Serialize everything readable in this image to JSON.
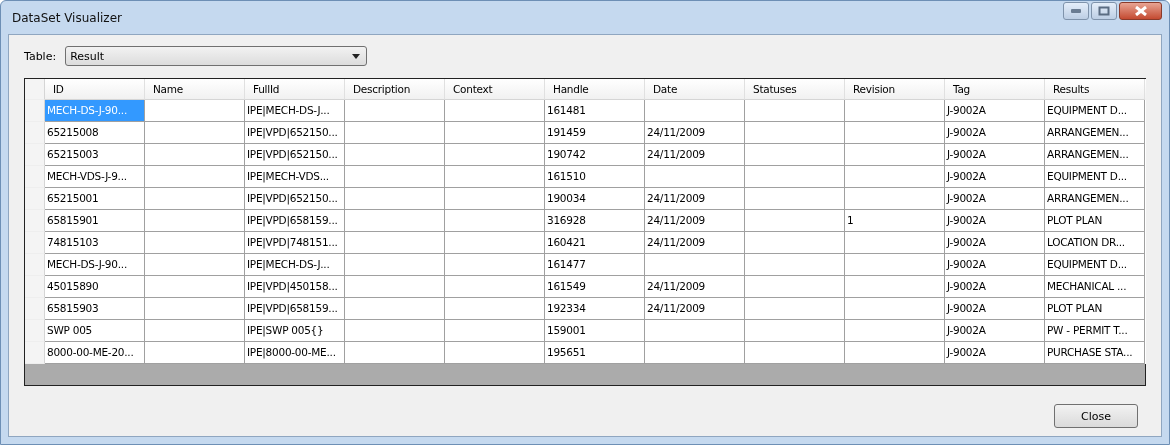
{
  "window": {
    "title": "DataSet Visualizer"
  },
  "table_selector": {
    "label": "Table:",
    "value": "Result"
  },
  "grid": {
    "columns": [
      "ID",
      "Name",
      "FullId",
      "Description",
      "Context",
      "Handle",
      "Date",
      "Statuses",
      "Revision",
      "Tag",
      "Results"
    ],
    "rows": [
      {
        "selected": true,
        "cells": [
          "MECH-DS-J-90...",
          null,
          "IPE|MECH-DS-J...",
          null,
          null,
          "161481",
          null,
          null,
          null,
          "J-9002A",
          "EQUIPMENT D..."
        ]
      },
      {
        "selected": false,
        "cells": [
          "65215008",
          null,
          "IPE|VPD|652150...",
          null,
          null,
          "191459",
          "24/11/2009",
          null,
          null,
          "J-9002A",
          "ARRANGEMEN..."
        ]
      },
      {
        "selected": false,
        "cells": [
          "65215003",
          null,
          "IPE|VPD|652150...",
          null,
          null,
          "190742",
          "24/11/2009",
          null,
          null,
          "J-9002A",
          "ARRANGEMEN..."
        ]
      },
      {
        "selected": false,
        "cells": [
          "MECH-VDS-J-9...",
          null,
          "IPE|MECH-VDS...",
          null,
          null,
          "161510",
          null,
          null,
          null,
          "J-9002A",
          "EQUIPMENT D..."
        ]
      },
      {
        "selected": false,
        "cells": [
          "65215001",
          null,
          "IPE|VPD|652150...",
          null,
          null,
          "190034",
          "24/11/2009",
          null,
          null,
          "J-9002A",
          "ARRANGEMEN..."
        ]
      },
      {
        "selected": false,
        "cells": [
          "65815901",
          null,
          "IPE|VPD|658159...",
          null,
          null,
          "316928",
          "24/11/2009",
          null,
          "1",
          "J-9002A",
          "PLOT PLAN"
        ]
      },
      {
        "selected": false,
        "cells": [
          "74815103",
          null,
          "IPE|VPD|748151...",
          null,
          null,
          "160421",
          "24/11/2009",
          null,
          null,
          "J-9002A",
          "LOCATION DR..."
        ]
      },
      {
        "selected": false,
        "cells": [
          "MECH-DS-J-90...",
          null,
          "IPE|MECH-DS-J...",
          null,
          null,
          "161477",
          null,
          null,
          null,
          "J-9002A",
          "EQUIPMENT D..."
        ]
      },
      {
        "selected": false,
        "cells": [
          "45015890",
          null,
          "IPE|VPD|450158...",
          null,
          null,
          "161549",
          "24/11/2009",
          null,
          null,
          "J-9002A",
          "MECHANICAL ..."
        ]
      },
      {
        "selected": false,
        "cells": [
          "65815903",
          null,
          "IPE|VPD|658159...",
          null,
          null,
          "192334",
          "24/11/2009",
          null,
          null,
          "J-9002A",
          "PLOT PLAN"
        ]
      },
      {
        "selected": false,
        "cells": [
          "SWP 005",
          null,
          "IPE|SWP 005{}",
          null,
          null,
          "159001",
          null,
          null,
          null,
          "J-9002A",
          "PW - PERMIT T..."
        ]
      },
      {
        "selected": false,
        "cells": [
          "8000-00-ME-20...",
          null,
          "IPE|8000-00-ME...",
          null,
          null,
          "195651",
          null,
          null,
          null,
          "J-9002A",
          "PURCHASE STA..."
        ]
      }
    ]
  },
  "buttons": [
    {
      "label": "Close"
    }
  ]
}
